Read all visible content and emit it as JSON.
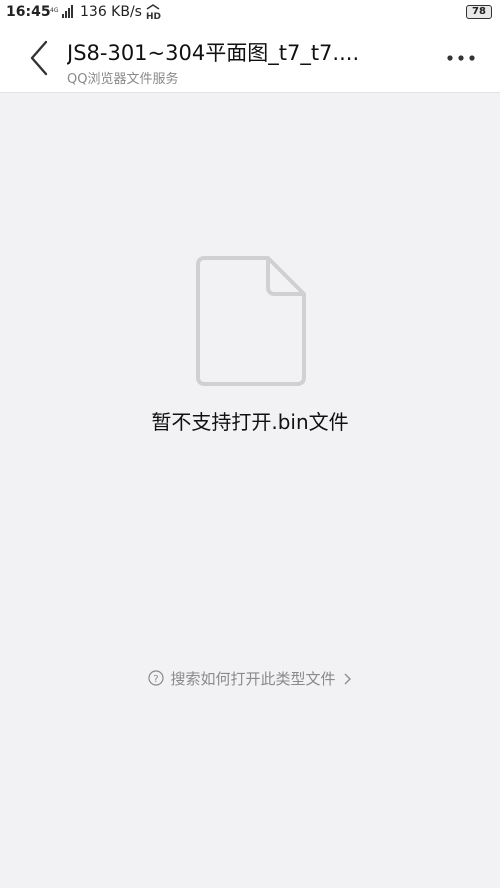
{
  "status_bar": {
    "time": "16:45",
    "network_speed": "136 KB/s",
    "battery_level": "78"
  },
  "header": {
    "title": "JS8-301~304平面图_t7_t7....",
    "subtitle": "QQ浏览器文件服务"
  },
  "main": {
    "message": "暂不支持打开.bin文件",
    "help_link_label": "搜索如何打开此类型文件"
  },
  "icons": {
    "back": "back-arrow-icon",
    "more": "more-dots-icon",
    "file": "document-icon",
    "help": "question-circle-icon",
    "chevron": "chevron-right-icon"
  },
  "colors": {
    "background": "#f2f2f5",
    "header": "#ffffff",
    "icon_gray": "#d0d0d3",
    "secondary_text": "#8a8a8a"
  }
}
